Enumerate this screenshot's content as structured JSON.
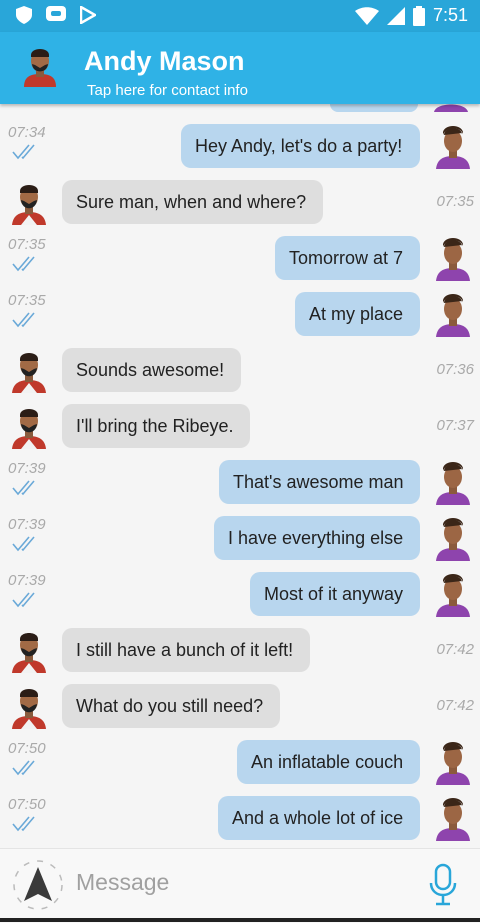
{
  "status_bar": {
    "time": "7:51"
  },
  "header": {
    "contact_name": "Andy Mason",
    "subtitle": "Tap here for contact info"
  },
  "messages": [
    {
      "dir": "out",
      "text": "Hey Andy, let's do a party!",
      "time": "07:34"
    },
    {
      "dir": "in",
      "text": "Sure man, when and where?",
      "time": "07:35"
    },
    {
      "dir": "out",
      "text": "Tomorrow at 7",
      "time": "07:35"
    },
    {
      "dir": "out",
      "text": "At my place",
      "time": "07:35"
    },
    {
      "dir": "in",
      "text": "Sounds awesome!",
      "time": "07:36"
    },
    {
      "dir": "in",
      "text": "I'll bring the Ribeye.",
      "time": "07:37"
    },
    {
      "dir": "out",
      "text": "That's awesome man",
      "time": "07:39"
    },
    {
      "dir": "out",
      "text": "I have everything else",
      "time": "07:39"
    },
    {
      "dir": "out",
      "text": "Most of it anyway",
      "time": "07:39"
    },
    {
      "dir": "in",
      "text": "I still have a bunch of it left!",
      "time": "07:42"
    },
    {
      "dir": "in",
      "text": "What do you still need?",
      "time": "07:42"
    },
    {
      "dir": "out",
      "text": "An inflatable couch",
      "time": "07:50"
    },
    {
      "dir": "out",
      "text": "And a whole lot of ice",
      "time": "07:50"
    }
  ],
  "composer": {
    "placeholder": "Message"
  },
  "icons": {
    "status": [
      "shield-icon",
      "message-icon",
      "play-store-icon",
      "wifi-icon",
      "cell-signal-icon",
      "battery-icon"
    ],
    "composer": [
      "navigation-arrow-icon",
      "microphone-icon"
    ],
    "message": "double-check-icon"
  },
  "colors": {
    "appbar": "#2fb2e6",
    "statusbar": "#29a6d9",
    "outgoing_bubble": "#b8d6ee",
    "incoming_bubble": "#dedede"
  }
}
